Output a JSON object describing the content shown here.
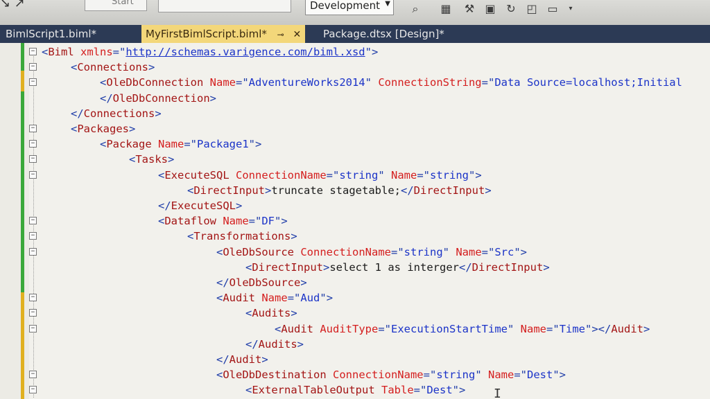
{
  "toolbar": {
    "start_label": "Start",
    "config_value": "Development"
  },
  "tabs": [
    {
      "label": "BimlScript1.biml*",
      "active": false
    },
    {
      "label": "MyFirstBimlScript.biml*",
      "active": true
    },
    {
      "label": "Package.dtsx [Design]*",
      "active": false
    }
  ],
  "icons": {
    "tab_pin": "pin-icon",
    "tab_close": "close-icon"
  },
  "code_lines": [
    {
      "indent": 0,
      "parts": [
        [
          "b",
          "<"
        ],
        [
          "t",
          "Biml"
        ],
        [
          "a",
          " xmlns"
        ],
        [
          "b",
          "=\""
        ],
        [
          "u",
          "http://schemas.varigence.com/biml.xsd"
        ],
        [
          "b",
          "\">"
        ]
      ]
    },
    {
      "indent": 1,
      "parts": [
        [
          "b",
          "<"
        ],
        [
          "t",
          "Connections"
        ],
        [
          "b",
          ">"
        ]
      ]
    },
    {
      "indent": 2,
      "parts": [
        [
          "b",
          "<"
        ],
        [
          "t",
          "OleDbConnection"
        ],
        [
          "a",
          " Name"
        ],
        [
          "b",
          "=\""
        ],
        [
          "v",
          "AdventureWorks2014"
        ],
        [
          "b",
          "\""
        ],
        [
          "a",
          " ConnectionString"
        ],
        [
          "b",
          "=\""
        ],
        [
          "v",
          "Data Source=localhost;Initial"
        ]
      ]
    },
    {
      "indent": 2,
      "parts": [
        [
          "b",
          "</"
        ],
        [
          "t",
          "OleDbConnection"
        ],
        [
          "b",
          ">"
        ]
      ]
    },
    {
      "indent": 1,
      "parts": [
        [
          "b",
          "</"
        ],
        [
          "t",
          "Connections"
        ],
        [
          "b",
          ">"
        ]
      ]
    },
    {
      "indent": 1,
      "parts": [
        [
          "b",
          "<"
        ],
        [
          "t",
          "Packages"
        ],
        [
          "b",
          ">"
        ]
      ]
    },
    {
      "indent": 2,
      "parts": [
        [
          "b",
          "<"
        ],
        [
          "t",
          "Package"
        ],
        [
          "a",
          " Name"
        ],
        [
          "b",
          "=\""
        ],
        [
          "v",
          "Package1"
        ],
        [
          "b",
          "\">"
        ]
      ]
    },
    {
      "indent": 3,
      "parts": [
        [
          "b",
          "<"
        ],
        [
          "t",
          "Tasks"
        ],
        [
          "b",
          ">"
        ]
      ]
    },
    {
      "indent": 4,
      "parts": [
        [
          "b",
          "<"
        ],
        [
          "t",
          "ExecuteSQL"
        ],
        [
          "a",
          " ConnectionName"
        ],
        [
          "b",
          "=\""
        ],
        [
          "v",
          "string"
        ],
        [
          "b",
          "\""
        ],
        [
          "a",
          " Name"
        ],
        [
          "b",
          "=\""
        ],
        [
          "v",
          "string"
        ],
        [
          "b",
          "\">"
        ]
      ]
    },
    {
      "indent": 5,
      "parts": [
        [
          "b",
          "<"
        ],
        [
          "t",
          "DirectInput"
        ],
        [
          "b",
          ">"
        ],
        [
          "k",
          "truncate stagetable;"
        ],
        [
          "b",
          "</"
        ],
        [
          "t",
          "DirectInput"
        ],
        [
          "b",
          ">"
        ]
      ]
    },
    {
      "indent": 4,
      "parts": [
        [
          "b",
          "</"
        ],
        [
          "t",
          "ExecuteSQL"
        ],
        [
          "b",
          ">"
        ]
      ]
    },
    {
      "indent": 4,
      "parts": [
        [
          "b",
          "<"
        ],
        [
          "t",
          "Dataflow"
        ],
        [
          "a",
          " Name"
        ],
        [
          "b",
          "=\""
        ],
        [
          "v",
          "DF"
        ],
        [
          "b",
          "\">"
        ]
      ]
    },
    {
      "indent": 5,
      "parts": [
        [
          "b",
          "<"
        ],
        [
          "t",
          "Transformations"
        ],
        [
          "b",
          ">"
        ]
      ]
    },
    {
      "indent": 6,
      "parts": [
        [
          "b",
          "<"
        ],
        [
          "t",
          "OleDbSource"
        ],
        [
          "a",
          " ConnectionName"
        ],
        [
          "b",
          "=\""
        ],
        [
          "v",
          "string"
        ],
        [
          "b",
          "\""
        ],
        [
          "a",
          " Name"
        ],
        [
          "b",
          "=\""
        ],
        [
          "v",
          "Src"
        ],
        [
          "b",
          "\">"
        ]
      ]
    },
    {
      "indent": 7,
      "parts": [
        [
          "b",
          "<"
        ],
        [
          "t",
          "DirectInput"
        ],
        [
          "b",
          ">"
        ],
        [
          "k",
          "select 1 as interger"
        ],
        [
          "b",
          "</"
        ],
        [
          "t",
          "DirectInput"
        ],
        [
          "b",
          ">"
        ]
      ]
    },
    {
      "indent": 6,
      "parts": [
        [
          "b",
          "</"
        ],
        [
          "t",
          "OleDbSource"
        ],
        [
          "b",
          ">"
        ]
      ]
    },
    {
      "indent": 6,
      "parts": [
        [
          "b",
          "<"
        ],
        [
          "t",
          "Audit"
        ],
        [
          "a",
          " Name"
        ],
        [
          "b",
          "=\""
        ],
        [
          "v",
          "Aud"
        ],
        [
          "b",
          "\">"
        ]
      ]
    },
    {
      "indent": 7,
      "parts": [
        [
          "b",
          "<"
        ],
        [
          "t",
          "Audits"
        ],
        [
          "b",
          ">"
        ]
      ]
    },
    {
      "indent": 8,
      "parts": [
        [
          "b",
          "<"
        ],
        [
          "t",
          "Audit"
        ],
        [
          "a",
          " AuditType"
        ],
        [
          "b",
          "=\""
        ],
        [
          "v",
          "ExecutionStartTime"
        ],
        [
          "b",
          "\""
        ],
        [
          "a",
          " Name"
        ],
        [
          "b",
          "=\""
        ],
        [
          "v",
          "Time"
        ],
        [
          "b",
          "\"></"
        ],
        [
          "t",
          "Audit"
        ],
        [
          "b",
          ">"
        ]
      ]
    },
    {
      "indent": 7,
      "parts": [
        [
          "b",
          "</"
        ],
        [
          "t",
          "Audits"
        ],
        [
          "b",
          ">"
        ]
      ]
    },
    {
      "indent": 6,
      "parts": [
        [
          "b",
          "</"
        ],
        [
          "t",
          "Audit"
        ],
        [
          "b",
          ">"
        ]
      ]
    },
    {
      "indent": 6,
      "parts": [
        [
          "b",
          "<"
        ],
        [
          "t",
          "OleDbDestination"
        ],
        [
          "a",
          " ConnectionName"
        ],
        [
          "b",
          "=\""
        ],
        [
          "v",
          "string"
        ],
        [
          "b",
          "\""
        ],
        [
          "a",
          " Name"
        ],
        [
          "b",
          "=\""
        ],
        [
          "v",
          "Dest"
        ],
        [
          "b",
          "\">"
        ]
      ]
    },
    {
      "indent": 7,
      "parts": [
        [
          "b",
          "<"
        ],
        [
          "t",
          "ExternalTableOutput"
        ],
        [
          "a",
          " Table"
        ],
        [
          "b",
          "=\""
        ],
        [
          "v",
          "Dest"
        ],
        [
          "b",
          "\">"
        ]
      ]
    }
  ],
  "colors": {
    "tag": "#a31515",
    "bracket": "#1e3ca8",
    "attribute": "#d41e1e",
    "value": "#1b33c8",
    "text": "#1b1b1b",
    "tab_active_bg": "#f3d77a",
    "tabbar_bg": "#2c3a55",
    "change_saved": "#3aa83a",
    "change_unsaved": "#e0b020"
  }
}
